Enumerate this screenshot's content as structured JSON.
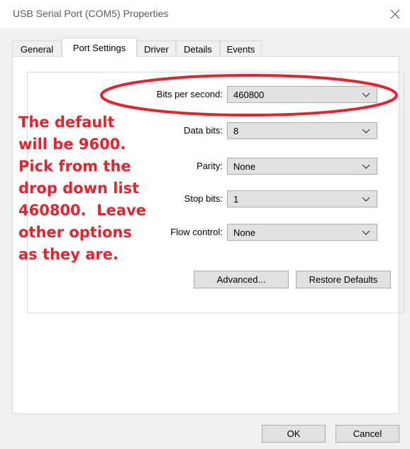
{
  "window": {
    "title": "USB Serial Port (COM5) Properties",
    "close_icon": "close-icon"
  },
  "tabs": [
    {
      "label": "General",
      "active": false
    },
    {
      "label": "Port Settings",
      "active": true
    },
    {
      "label": "Driver",
      "active": false
    },
    {
      "label": "Details",
      "active": false
    },
    {
      "label": "Events",
      "active": false
    }
  ],
  "settings": {
    "bits_per_second": {
      "label": "Bits per second:",
      "value": "460800"
    },
    "data_bits": {
      "label": "Data bits:",
      "value": "8"
    },
    "parity": {
      "label": "Parity:",
      "value": "None"
    },
    "stop_bits": {
      "label": "Stop bits:",
      "value": "1"
    },
    "flow_control": {
      "label": "Flow control:",
      "value": "None"
    }
  },
  "buttons": {
    "advanced": "Advanced...",
    "restore_defaults": "Restore Defaults",
    "ok": "OK",
    "cancel": "Cancel"
  },
  "annotation": {
    "lines": [
      "The default",
      "will be 9600.",
      "Pick from the",
      "drop down list",
      "460800.  Leave",
      "other options",
      "as they are."
    ],
    "color": "#e8212b"
  },
  "colors": {
    "accent": "#e8212b",
    "dialog_bg": "#f0f0f0",
    "button_bg": "#e1e1e1"
  }
}
